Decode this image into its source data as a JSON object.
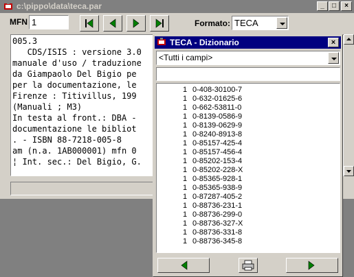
{
  "main_window": {
    "title": "c:\\pippo\\data\\teca.par",
    "title_buttons": [
      "_",
      "□",
      "×"
    ]
  },
  "toolbar": {
    "mfn_label": "MFN",
    "mfn_value": "1",
    "formato_label": "Formato:",
    "formato_value": "TECA"
  },
  "record_lines": [
    "005.3",
    "   CDS/ISIS : versione 3.0",
    "manuale d'uso / traduzione",
    "da Giampaolo Del Bigio pe",
    "per la documentazione, le",
    "Firenze : Titivillus, 199",
    "(Manuali ; M3)",
    "In testa al front.: DBA -",
    "documentazione le bibliot",
    ". - ISBN 88-7218-005-8",
    "am (n.a. 1AB000001) mfn 0",
    "¦ Int. sec.: Del Bigio, G."
  ],
  "dictionary_dialog": {
    "title": "TECA - Dizionario",
    "close": "×",
    "field_selector": "<Tutti i campi>",
    "search_value": "",
    "entries": [
      {
        "count": "1",
        "term": "0-408-30100-7"
      },
      {
        "count": "1",
        "term": "0-632-01625-6"
      },
      {
        "count": "1",
        "term": "0-662-53811-0"
      },
      {
        "count": "1",
        "term": "0-8139-0586-9"
      },
      {
        "count": "1",
        "term": "0-8139-0629-9"
      },
      {
        "count": "1",
        "term": "0-8240-8913-8"
      },
      {
        "count": "1",
        "term": "0-85157-425-4"
      },
      {
        "count": "1",
        "term": "0-85157-456-4"
      },
      {
        "count": "1",
        "term": "0-85202-153-4"
      },
      {
        "count": "1",
        "term": "0-85202-228-X"
      },
      {
        "count": "1",
        "term": "0-85365-928-1"
      },
      {
        "count": "1",
        "term": "0-85365-938-9"
      },
      {
        "count": "1",
        "term": "0-87287-405-2"
      },
      {
        "count": "1",
        "term": "0-88736-231-1"
      },
      {
        "count": "1",
        "term": "0-88736-299-0"
      },
      {
        "count": "1",
        "term": "0-88736-327-X"
      },
      {
        "count": "1",
        "term": "0-88736-331-8"
      },
      {
        "count": "1",
        "term": "0-88736-345-8"
      }
    ]
  },
  "colors": {
    "face": "#d4d0c8",
    "active_title": "#000080",
    "inactive_title": "#808080",
    "nav_arrow": "#008000"
  },
  "icons": [
    "app-icon",
    "dictionary-icon",
    "first-record-icon",
    "previous-record-icon",
    "next-record-icon",
    "last-record-icon",
    "printer-icon",
    "left-arrow-icon",
    "right-arrow-icon",
    "dropdown-arrow-icon"
  ]
}
